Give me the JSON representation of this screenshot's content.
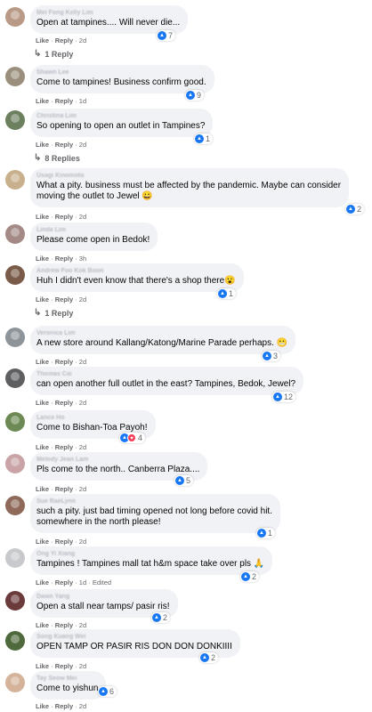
{
  "colors": {
    "accent": "#1877f2",
    "bubble": "#f0f2f5",
    "love": "#f33e58"
  },
  "comments": [
    {
      "name": "Mei Fong Kelly Lim",
      "text": [
        "Open at tampines.... Will never die..."
      ],
      "meta": {
        "like": "Like",
        "reply": "Reply",
        "time": "2d",
        "edited": ""
      },
      "reactions": {
        "icons": [
          "like-icon"
        ],
        "count": "7"
      },
      "replies": "1 Reply",
      "avatar": "#b99a86"
    },
    {
      "name": "Shawn Lee",
      "text": [
        "Come to tampines! Business confirm good."
      ],
      "meta": {
        "like": "Like",
        "reply": "Reply",
        "time": "1d",
        "edited": ""
      },
      "reactions": {
        "icons": [
          "like-icon"
        ],
        "count": "9"
      },
      "replies": "",
      "avatar": "#9a8f7c"
    },
    {
      "name": "Christina Lim",
      "text": [
        "So opening to open an outlet in Tampines?"
      ],
      "meta": {
        "like": "Like",
        "reply": "Reply",
        "time": "2d",
        "edited": ""
      },
      "reactions": {
        "icons": [
          "like-icon"
        ],
        "count": "1"
      },
      "replies": "8 Replies",
      "avatar": "#6c7f5e"
    },
    {
      "name": "Usagi Kinomoto",
      "text": [
        "What a pity. business must be affected by the pandemic. Maybe can consider",
        "moving the outlet to Jewel 😀"
      ],
      "meta": {
        "like": "Like",
        "reply": "Reply",
        "time": "2d",
        "edited": ""
      },
      "reactions": {
        "icons": [
          "like-icon"
        ],
        "count": "2"
      },
      "replies": "",
      "avatar": "#c9b08c"
    },
    {
      "name": "Linda Lim",
      "text": [
        "Please come open in Bedok!"
      ],
      "meta": {
        "like": "Like",
        "reply": "Reply",
        "time": "3h",
        "edited": ""
      },
      "reactions": null,
      "replies": "",
      "avatar": "#a48a86"
    },
    {
      "name": "Andrew Foo Kok Boon",
      "text": [
        "Huh I didn't even know that there's a shop there😮"
      ],
      "meta": {
        "like": "Like",
        "reply": "Reply",
        "time": "2d",
        "edited": ""
      },
      "reactions": {
        "icons": [
          "like-icon"
        ],
        "count": "1"
      },
      "replies": "1 Reply",
      "avatar": "#7a5a48"
    },
    {
      "name": "Veronica Lim",
      "text": [
        "A new store around Kallang/Katong/Marine Parade perhaps. 😬"
      ],
      "meta": {
        "like": "Like",
        "reply": "Reply",
        "time": "2d",
        "edited": ""
      },
      "reactions": {
        "icons": [
          "like-icon"
        ],
        "count": "3"
      },
      "replies": "",
      "avatar": "#8d949a"
    },
    {
      "name": "Thomas Cai",
      "text": [
        "can open another full outlet in the east? Tampines, Bedok, Jewel?"
      ],
      "meta": {
        "like": "Like",
        "reply": "Reply",
        "time": "2d",
        "edited": ""
      },
      "reactions": {
        "icons": [
          "like-icon"
        ],
        "count": "12"
      },
      "replies": "",
      "avatar": "#5d5f61"
    },
    {
      "name": "Lance Ho",
      "text": [
        "Come to Bishan-Toa Payoh!"
      ],
      "meta": {
        "like": "Like",
        "reply": "Reply",
        "time": "2d",
        "edited": ""
      },
      "reactions": {
        "icons": [
          "like-icon",
          "love-icon"
        ],
        "count": "4"
      },
      "replies": "",
      "avatar": "#6e8a54"
    },
    {
      "name": "Melody Jean Lam",
      "text": [
        "Pls come to the north.. Canberra Plaza...."
      ],
      "meta": {
        "like": "Like",
        "reply": "Reply",
        "time": "2d",
        "edited": ""
      },
      "reactions": {
        "icons": [
          "like-icon"
        ],
        "count": "5"
      },
      "replies": "",
      "avatar": "#c9a3a6"
    },
    {
      "name": "Sue RaeLynn",
      "text": [
        "such a pity. just bad timing opened not long before covid hit.",
        "somewhere in the north please!"
      ],
      "meta": {
        "like": "Like",
        "reply": "Reply",
        "time": "2d",
        "edited": ""
      },
      "reactions": {
        "icons": [
          "like-icon"
        ],
        "count": "1"
      },
      "replies": "",
      "avatar": "#8f6a5a"
    },
    {
      "name": "Ong Yi Xiang",
      "text": [
        "Tampines ! Tampines mall tat h&m space take over pls 🙏"
      ],
      "meta": {
        "like": "Like",
        "reply": "Reply",
        "time": "1d",
        "edited": "Edited"
      },
      "reactions": {
        "icons": [
          "like-icon"
        ],
        "count": "2"
      },
      "replies": "",
      "avatar": "#c7c9cc"
    },
    {
      "name": "Dawn Yang",
      "text": [
        "Open a stall near tamps/ pasir ris!"
      ],
      "meta": {
        "like": "Like",
        "reply": "Reply",
        "time": "2d",
        "edited": ""
      },
      "reactions": {
        "icons": [
          "like-icon"
        ],
        "count": "2"
      },
      "replies": "",
      "avatar": "#6b3a3a"
    },
    {
      "name": "Song Kuang Wei",
      "text": [
        "OPEN TAMP OR PASIR RIS DON DON DONKIIII"
      ],
      "meta": {
        "like": "Like",
        "reply": "Reply",
        "time": "2d",
        "edited": ""
      },
      "reactions": {
        "icons": [
          "like-icon"
        ],
        "count": "2"
      },
      "replies": "",
      "avatar": "#4e6a3c"
    },
    {
      "name": "Tay Seow Mei",
      "text": [
        "Come to yishun"
      ],
      "meta": {
        "like": "Like",
        "reply": "Reply",
        "time": "2d",
        "edited": ""
      },
      "reactions": {
        "icons": [
          "like-icon"
        ],
        "count": "6"
      },
      "replies": "",
      "avatar": "#d4b39a"
    }
  ]
}
